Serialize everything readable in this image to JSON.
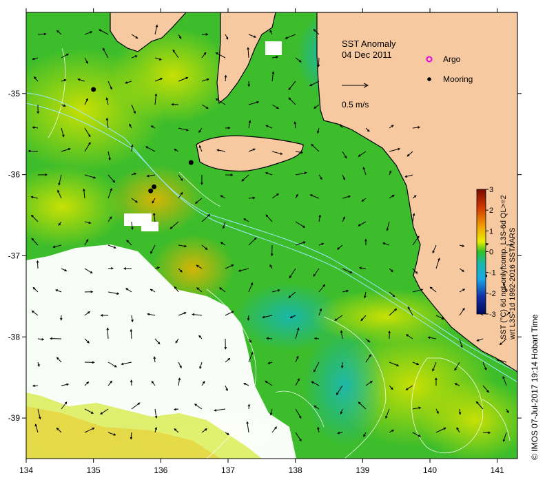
{
  "map": {
    "title": "SST Anomaly",
    "date": "04 Dec 2011",
    "x_ticks": [
      "134",
      "135",
      "136",
      "137",
      "138",
      "139",
      "140",
      "141"
    ],
    "y_ticks": [
      "-35",
      "-36",
      "-37",
      "-38",
      "-39"
    ],
    "legend": {
      "argo_label": "Argo",
      "mooring_label": "Mooring",
      "scale_label": "0.5 m/s"
    },
    "colorbar": {
      "ticks": [
        "3",
        "2",
        "1",
        "0",
        "-1",
        "-2",
        "-3"
      ],
      "title_line1": "SST (°C) 6d ngt-only comp. L3S-6d QL>=2",
      "title_line2": "wrt L3S-1d 1992-2016 SSTAARS"
    },
    "credit": "© IMOS 07-Jul-2017 19:14 Hobart Time",
    "colors": {
      "land": "#f7c9a0",
      "sea_base": "#3cbf2a",
      "anomaly_warm": "#c8e000",
      "anomaly_cool": "#1fb0b0",
      "missing": "#ffffff",
      "isobath": "#9ee9ff"
    },
    "moorings": [
      {
        "lon": 135.0,
        "lat": -34.95
      },
      {
        "lon": 136.45,
        "lat": -35.85
      },
      {
        "lon": 135.85,
        "lat": -36.2
      },
      {
        "lon": 135.9,
        "lat": -36.15
      }
    ]
  }
}
